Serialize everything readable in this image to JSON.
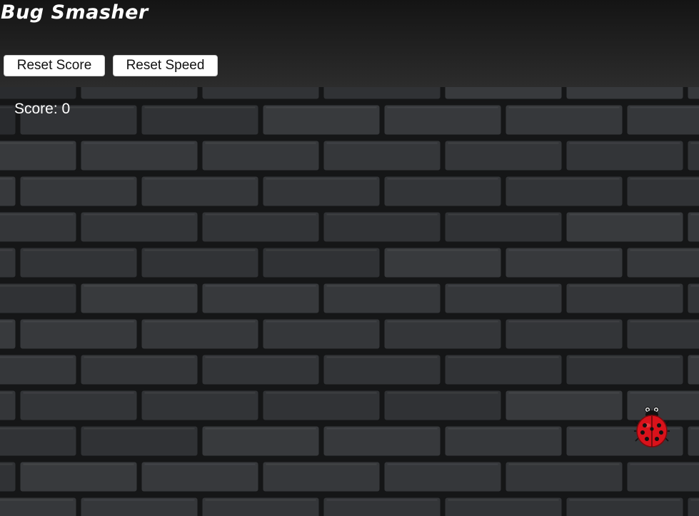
{
  "game": {
    "title": "Bug Smasher",
    "buttons": {
      "reset_score": "Reset Score",
      "reset_speed": "Reset Speed"
    },
    "score_label": "Score: 0"
  },
  "colors": {
    "header_top": "#141414",
    "header_bottom": "#2c2c2c",
    "brick": "#34373a",
    "mortar": "#151617",
    "ladybug_shell": "#d9121b",
    "ladybug_spots": "#111111"
  },
  "icons": {
    "bug": "ladybug-icon"
  }
}
